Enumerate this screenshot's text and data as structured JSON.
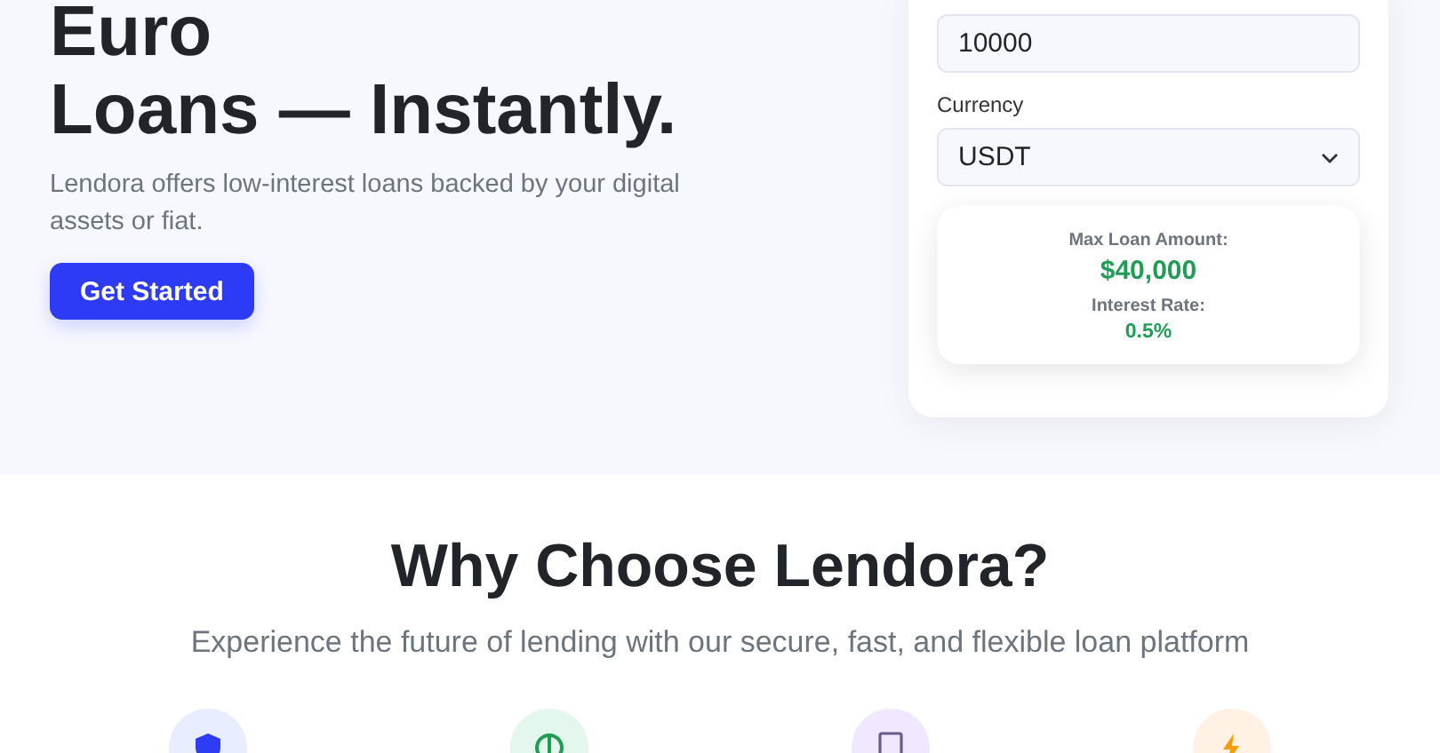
{
  "hero": {
    "heading_lines": [
      "Euro",
      "Loans — Instantly."
    ],
    "description": "Lendora offers low-interest loans backed by your digital assets or fiat.",
    "cta": "Get Started"
  },
  "calculator": {
    "amount": {
      "value": "10000"
    },
    "currency": {
      "label": "Currency",
      "value": "USDT"
    },
    "results": [
      {
        "label": "Max Loan Amount:",
        "value": "$40,000",
        "kind": "large"
      },
      {
        "label": "Interest Rate:",
        "value": "0.5%",
        "kind": "small"
      }
    ]
  },
  "features": {
    "title": "Why Choose Lendora?",
    "subtitle": "Experience the future of lending with our secure, fast, and flexible loan platform",
    "items": [
      {
        "kind": "shield",
        "color": "#e8edff"
      },
      {
        "kind": "dollar",
        "color": "#e3f7ec"
      },
      {
        "kind": "device",
        "color": "#f1e8ff"
      },
      {
        "kind": "bolt",
        "color": "#fff1e3"
      }
    ]
  }
}
